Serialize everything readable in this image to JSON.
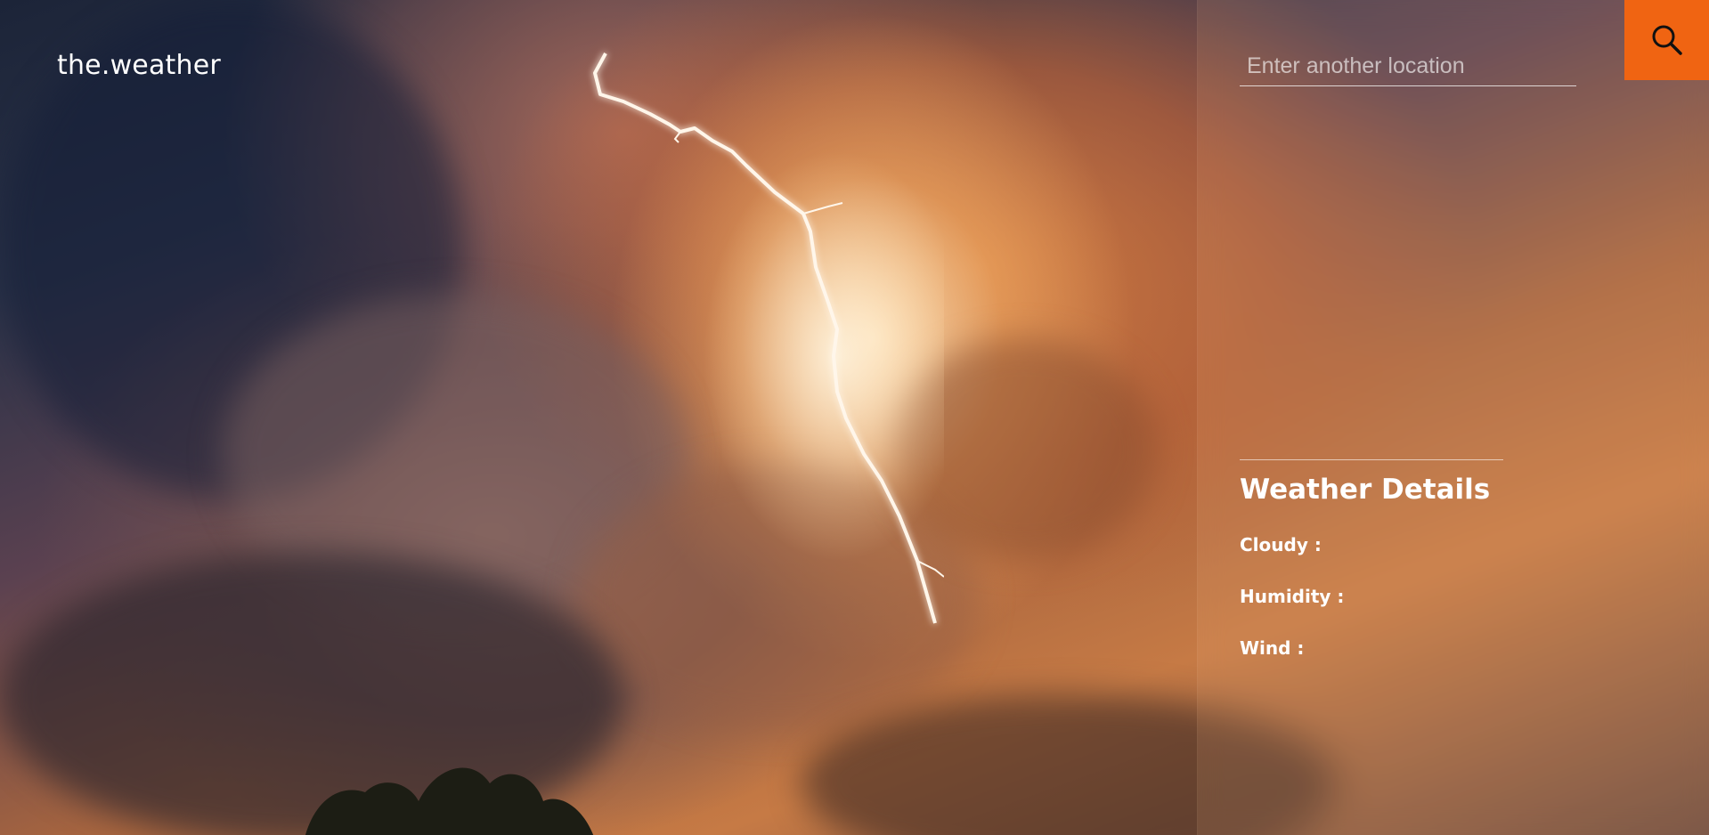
{
  "app": {
    "logo": "the.weather"
  },
  "search": {
    "placeholder": "Enter another location",
    "button_icon": "search-icon"
  },
  "details": {
    "title": "Weather Details",
    "items": [
      {
        "label": "Cloudy :"
      },
      {
        "label": "Humidity :"
      },
      {
        "label": "Wind :"
      }
    ]
  },
  "colors": {
    "accent": "#f06412",
    "text": "#ffffff"
  }
}
